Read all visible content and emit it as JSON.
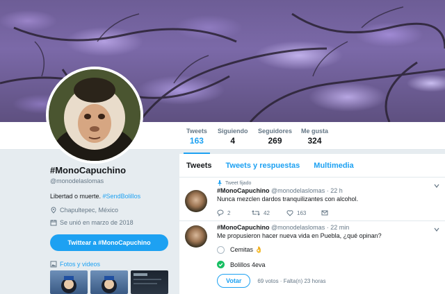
{
  "stats": [
    {
      "label": "Tweets",
      "value": "163",
      "active": true
    },
    {
      "label": "Siguiendo",
      "value": "4",
      "active": false
    },
    {
      "label": "Seguidores",
      "value": "269",
      "active": false
    },
    {
      "label": "Me gusta",
      "value": "324",
      "active": false
    }
  ],
  "profile": {
    "name": "#MonoCapuchino",
    "handle": "@monodelaslomas",
    "bio_text": "Libertad o muerte. ",
    "bio_tag": "#SendBolillos",
    "location": "Chapultepec, México",
    "joined": "Se unió en marzo de 2018",
    "tweet_to_button": "Twittear a #MonoCapuchino",
    "media_link": "Fotos y videos"
  },
  "tabs": [
    "Tweets",
    "Tweets y respuestas",
    "Multimedia"
  ],
  "tweets": [
    {
      "pinned_label": "Tweet fijado",
      "name": "#MonoCapuchino",
      "handle": "@monodelaslomas",
      "time": "· 22 h",
      "text": "Nunca mezclen dardos tranquilizantes con alcohol.",
      "replies": "2",
      "retweets": "42",
      "likes": "163"
    },
    {
      "name": "#MonoCapuchino",
      "handle": "@monodelaslomas",
      "time": "· 22 min",
      "text": "Me propusieron hacer nueva vida en Puebla, ¿qué opinan?",
      "poll_options": [
        "Cemitas 👌",
        "Bolillos 4eva"
      ],
      "vote_button": "Votar",
      "poll_meta": "69 votos · Falta(n) 23 horas"
    }
  ],
  "colors": {
    "accent": "#1da1f2",
    "poll_check": "#17bf63"
  }
}
